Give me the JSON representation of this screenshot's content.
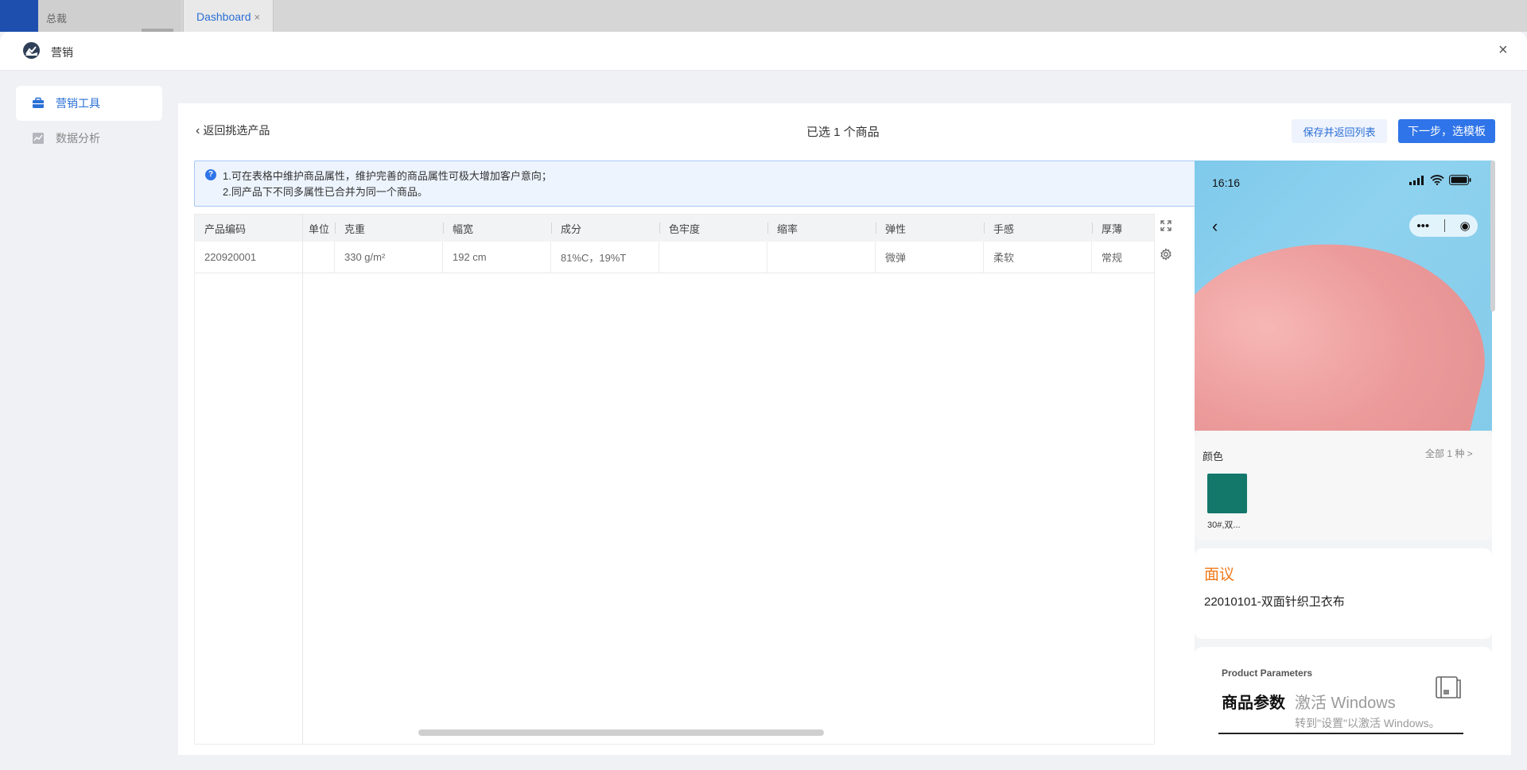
{
  "tabs": [
    {
      "label": "总裁"
    },
    {
      "label": "Dashboard",
      "close": "×"
    }
  ],
  "modal": {
    "title": "营销",
    "close": "×"
  },
  "sidebar": {
    "items": [
      {
        "label": "营销工具",
        "icon": "briefcase-icon",
        "active": true
      },
      {
        "label": "数据分析",
        "icon": "chart-icon",
        "active": false
      }
    ]
  },
  "toolbar": {
    "back_label": "返回挑选产品",
    "selected_text": "已选 1 个商品",
    "save_label": "保存并返回列表",
    "next_label": "下一步，选模板"
  },
  "notice": {
    "line1": "1.可在表格中维护商品属性，维护完善的商品属性可极大增加客户意向；",
    "line2": "2.同产品下不同多属性已合并为同一个商品。"
  },
  "table": {
    "headers": [
      "产品编码",
      "单位",
      "克重",
      "幅宽",
      "成分",
      "色牢度",
      "缩率",
      "弹性",
      "手感",
      "厚薄"
    ],
    "rows": [
      [
        "220920001",
        "",
        "330 g/m²",
        "192 cm",
        "81%C，19%T",
        "",
        "",
        "微弹",
        "柔软",
        "常规"
      ]
    ]
  },
  "preview": {
    "time": "16:16",
    "color_label": "颜色",
    "all_colors": "全部 1 种 >",
    "swatch_color": "#13776a",
    "swatch_label": "30#,双...",
    "price": "面议",
    "product_name": "22010101-双面针织卫衣布",
    "params_en": "Product Parameters",
    "params_cn": "商品参数",
    "watermark_line1": "激活 Windows",
    "watermark_line2": "转到\"设置\"以激活 Windows。"
  }
}
